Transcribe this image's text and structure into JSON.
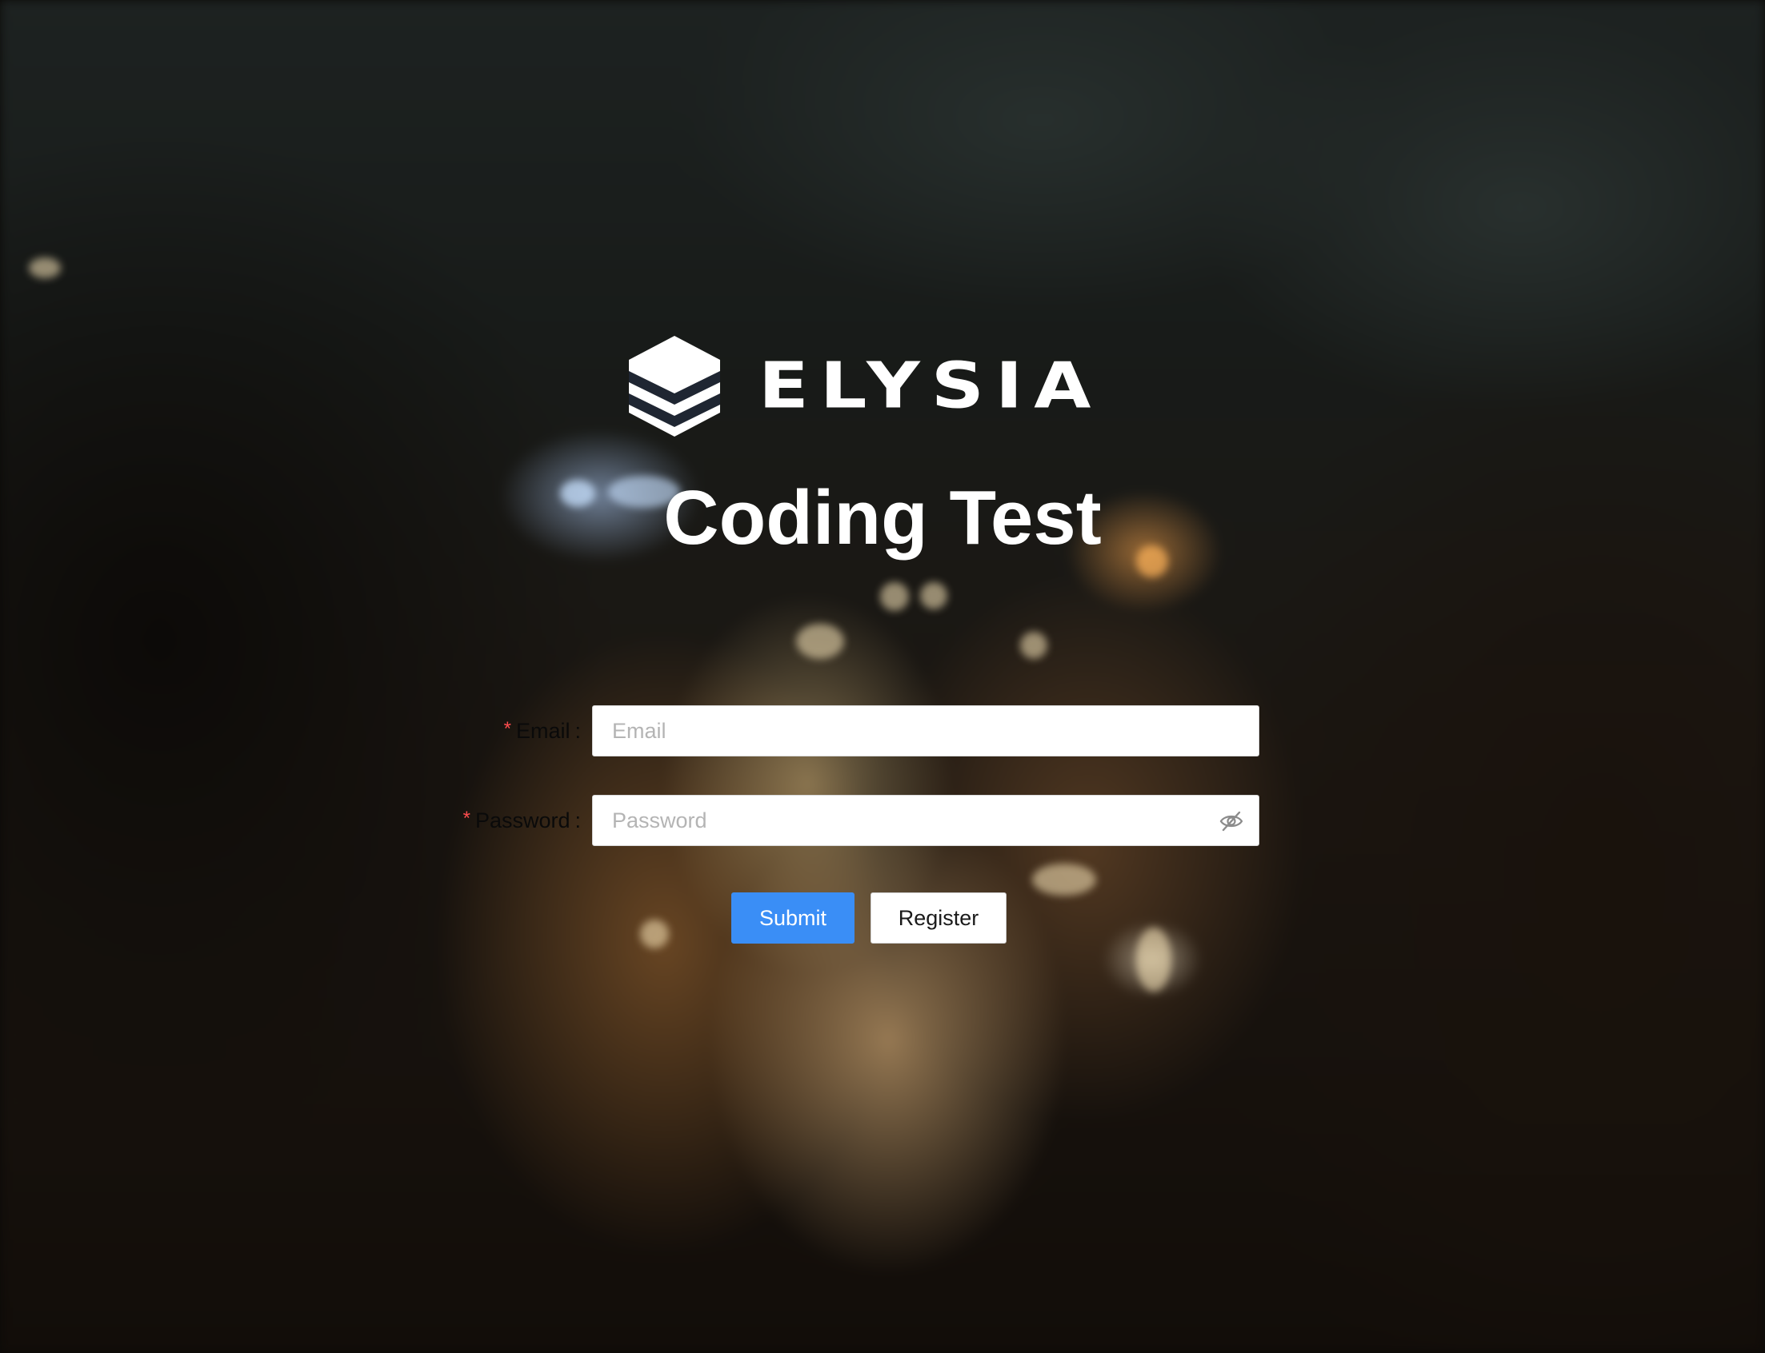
{
  "brand": {
    "name": "ELYSIA"
  },
  "page": {
    "title": "Coding Test"
  },
  "form": {
    "email": {
      "required_mark": "*",
      "label": "Email",
      "colon": ":",
      "value": "",
      "placeholder": "Email"
    },
    "password": {
      "required_mark": "*",
      "label": "Password",
      "colon": ":",
      "value": "",
      "placeholder": "Password",
      "visibility_icon": "eye-slash-icon"
    },
    "submit_label": "Submit",
    "register_label": "Register"
  },
  "colors": {
    "primary": "#3a8ef6",
    "required": "#ff4d4f",
    "title": "#ffffff"
  }
}
